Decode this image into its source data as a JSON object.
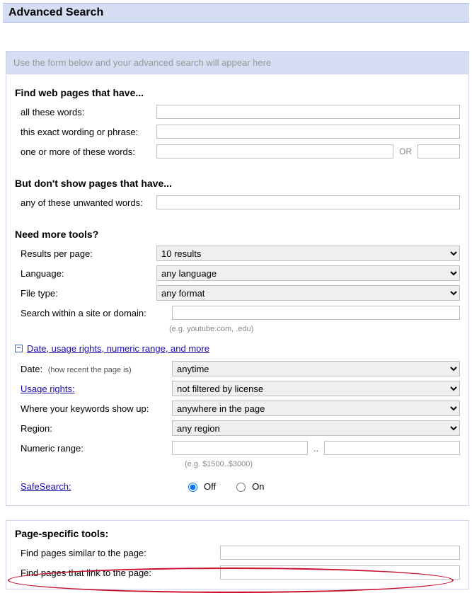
{
  "header": {
    "title": "Advanced Search"
  },
  "preview": {
    "placeholder": "Use the form below and your advanced search will appear here"
  },
  "find": {
    "title": "Find web pages that have...",
    "all_label": "all these words:",
    "exact_label": "this exact wording or phrase:",
    "any_label": "one or more of these words:",
    "or_sep": "OR"
  },
  "exclude": {
    "title": "But don't show pages that have...",
    "unwanted_label": "any of these unwanted words:"
  },
  "tools": {
    "title": "Need more tools?",
    "rpp_label": "Results per page:",
    "rpp_value": "10 results",
    "lang_label": "Language:",
    "lang_value": "any language",
    "ft_label": "File type:",
    "ft_value": "any format",
    "site_label": "Search within a site or domain:",
    "site_hint": "(e.g. youtube.com, .edu)"
  },
  "expander": {
    "label": "Date, usage rights, numeric range, and more",
    "icon": "−"
  },
  "adv": {
    "date_label": "Date:",
    "date_note": "(how recent the page is)",
    "date_value": "anytime",
    "rights_label": "Usage rights:",
    "rights_value": "not filtered by license",
    "where_label": "Where your keywords show up:",
    "where_value": "anywhere in the page",
    "region_label": "Region:",
    "region_value": "any region",
    "numeric_label": "Numeric range:",
    "numeric_sep": "..",
    "numeric_hint": "(e.g. $1500..$3000)",
    "safesearch_label": "SafeSearch:",
    "safesearch_off": "Off",
    "safesearch_on": "On"
  },
  "pagetools": {
    "title": "Page-specific tools:",
    "similar_label": "Find pages similar to the page:",
    "link_label": "Find pages that link to the page:"
  }
}
